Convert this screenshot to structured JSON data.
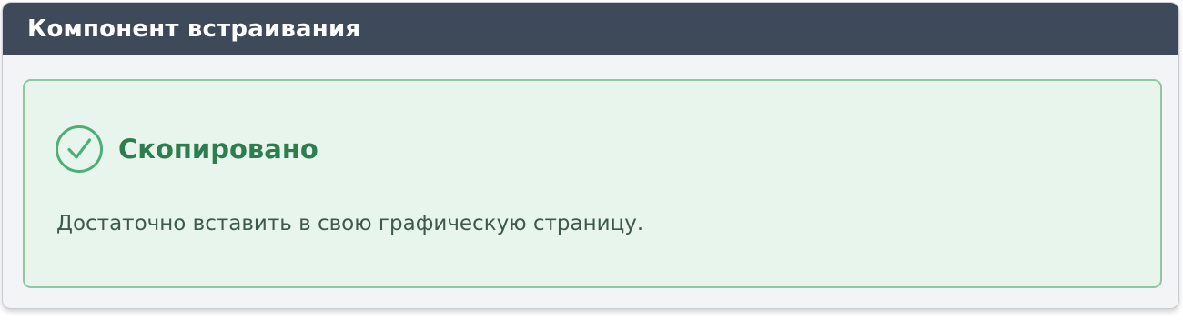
{
  "header": {
    "title": "Компонент встраивания"
  },
  "alert": {
    "icon": "check-circle-icon",
    "title": "Скопировано",
    "message": "Достаточно вставить в свою графическую страницу."
  },
  "colors": {
    "header_bg": "#3e4a59",
    "success_border": "#8fc7a2",
    "success_bg": "#e7f5ec",
    "success_text": "#2e7d4f"
  }
}
